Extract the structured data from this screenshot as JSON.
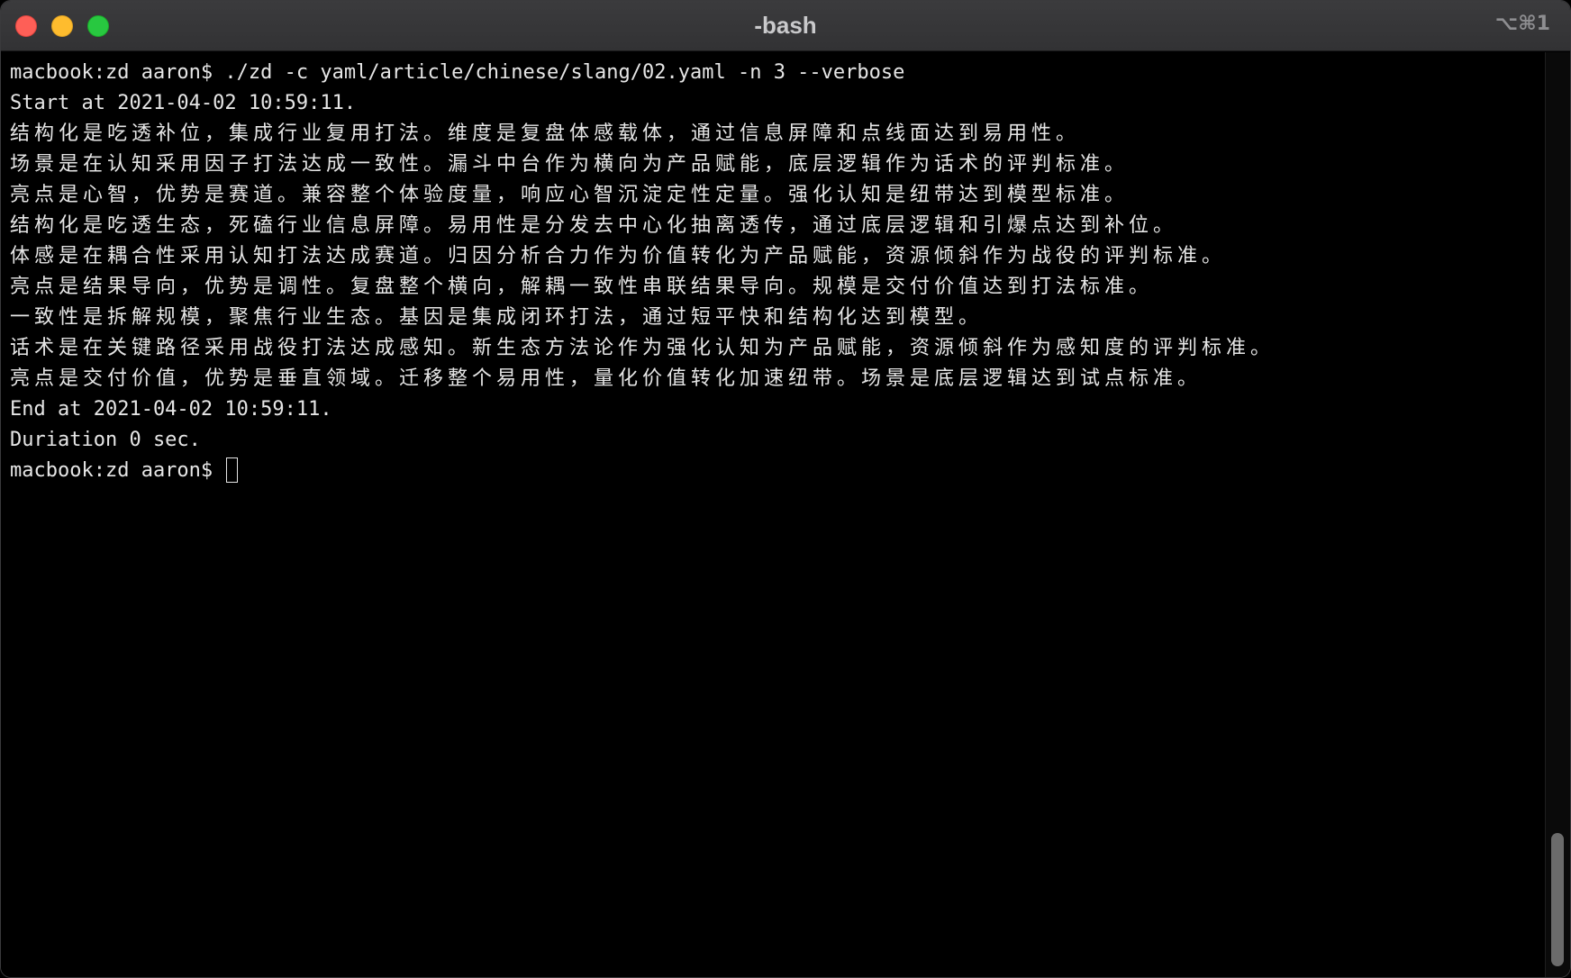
{
  "window": {
    "title": "-bash",
    "shortcut": "⌥⌘1"
  },
  "terminal": {
    "command_line": "macbook:zd aaron$ ./zd -c yaml/article/chinese/slang/02.yaml -n 3 --verbose",
    "start_line": "Start at 2021-04-02 10:59:11.",
    "output": [
      "结构化是吃透补位，集成行业复用打法。维度是复盘体感载体，通过信息屏障和点线面达到易用性。",
      "场景是在认知采用因子打法达成一致性。漏斗中台作为横向为产品赋能，底层逻辑作为话术的评判标准。",
      "亮点是心智，优势是赛道。兼容整个体验度量，响应心智沉淀定性定量。强化认知是纽带达到模型标准。",
      "结构化是吃透生态，死磕行业信息屏障。易用性是分发去中心化抽离透传，通过底层逻辑和引爆点达到补位。",
      "体感是在耦合性采用认知打法达成赛道。归因分析合力作为价值转化为产品赋能，资源倾斜作为战役的评判标准。",
      "亮点是结果导向，优势是调性。复盘整个横向，解耦一致性串联结果导向。规模是交付价值达到打法标准。",
      "一致性是拆解规模，聚焦行业生态。基因是集成闭环打法，通过短平快和结构化达到模型。",
      "话术是在关键路径采用战役打法达成感知。新生态方法论作为强化认知为产品赋能，资源倾斜作为感知度的评判标准。",
      "亮点是交付价值，优势是垂直领域。迁移整个易用性，量化价值转化加速纽带。场景是底层逻辑达到试点标准。"
    ],
    "end_line": "End at 2021-04-02 10:59:11.",
    "duration_line": "Duriation 0 sec.",
    "prompt": "macbook:zd aaron$ "
  }
}
